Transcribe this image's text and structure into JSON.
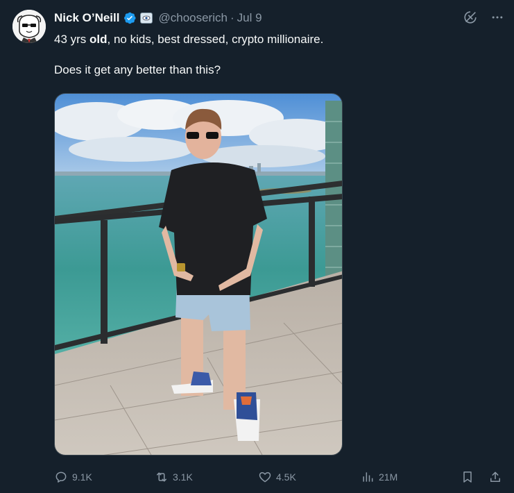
{
  "author": {
    "name": "Nick O’Neill",
    "handle": "@chooserich",
    "separator": "·",
    "date": "Jul 9"
  },
  "tweet": {
    "line1_before": "43 yrs ",
    "line1_bold": "old",
    "line1_after": ", no kids, best dressed, crypto millionaire.",
    "line2": "Does it get any better than this?"
  },
  "actions": {
    "replies": "9.1K",
    "reposts": "3.1K",
    "likes": "4.5K",
    "views": "21M"
  },
  "colors": {
    "background": "#15202b",
    "text": "#f7f9f9",
    "secondary": "#8b98a5",
    "verified": "#1d9bf0"
  },
  "icons": [
    "verified-badge-icon",
    "affiliate-badge-icon",
    "grok-icon",
    "more-icon",
    "reply-icon",
    "repost-icon",
    "like-icon",
    "views-icon",
    "bookmark-icon",
    "share-icon"
  ]
}
